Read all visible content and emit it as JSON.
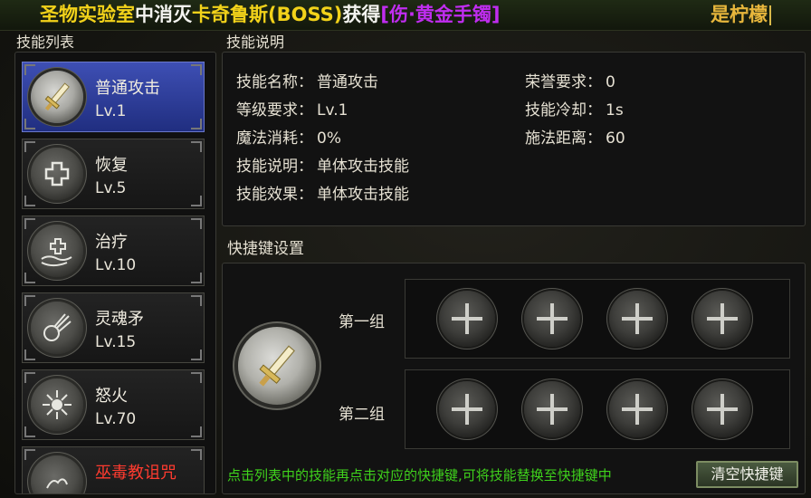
{
  "banner": {
    "segments": [
      {
        "text": "圣物实验室",
        "color": "#f2d21a"
      },
      {
        "text": "中消灭",
        "color": "#f4f4f0"
      },
      {
        "text": "卡奇鲁斯(BOSS)",
        "color": "#f2d21a"
      },
      {
        "text": "获得",
        "color": "#f4f4f0"
      },
      {
        "text": "[伤·黄金手镯]",
        "color": "#c02df0"
      }
    ],
    "right_text": "是柠檬",
    "right_color": "#e7b63c"
  },
  "skill_list": {
    "title": "技能列表",
    "items": [
      {
        "name": "普通攻击",
        "level": "Lv.1",
        "icon": "sword-icon",
        "selected": true
      },
      {
        "name": "恢复",
        "level": "Lv.5",
        "icon": "plus-heal-icon",
        "selected": false
      },
      {
        "name": "治疗",
        "level": "Lv.10",
        "icon": "hand-heal-icon",
        "selected": false
      },
      {
        "name": "灵魂矛",
        "level": "Lv.15",
        "icon": "soul-spear-icon",
        "selected": false
      },
      {
        "name": "怒火",
        "level": "Lv.70",
        "icon": "fury-icon",
        "selected": false
      },
      {
        "name": "巫毒教诅咒",
        "level": "",
        "icon": "voodoo-curse-icon",
        "selected": false,
        "color": "#ff3b2f"
      }
    ]
  },
  "skill_info": {
    "title": "技能说明",
    "name_label": "技能名称：",
    "name_value": "普通攻击",
    "level_label": "等级要求：",
    "level_value": "Lv.1",
    "mana_label": "魔法消耗：",
    "mana_value": "0%",
    "desc_label": "技能说明：",
    "desc_value": "单体攻击技能",
    "effect_label": "技能效果：",
    "effect_value": "单体攻击技能",
    "honor_label": "荣誉要求：",
    "honor_value": "0",
    "cooldown_label": "技能冷却：",
    "cooldown_value": "1s",
    "range_label": "施法距离：",
    "range_value": "60"
  },
  "shortcut": {
    "title": "快捷键设置",
    "group1_label": "第一组",
    "group2_label": "第二组",
    "slot_icon": "plus-icon",
    "hint": "点击列表中的技能再点击对应的快捷键,可将技能替换至快捷键中",
    "clear_label": "清空快捷键"
  }
}
